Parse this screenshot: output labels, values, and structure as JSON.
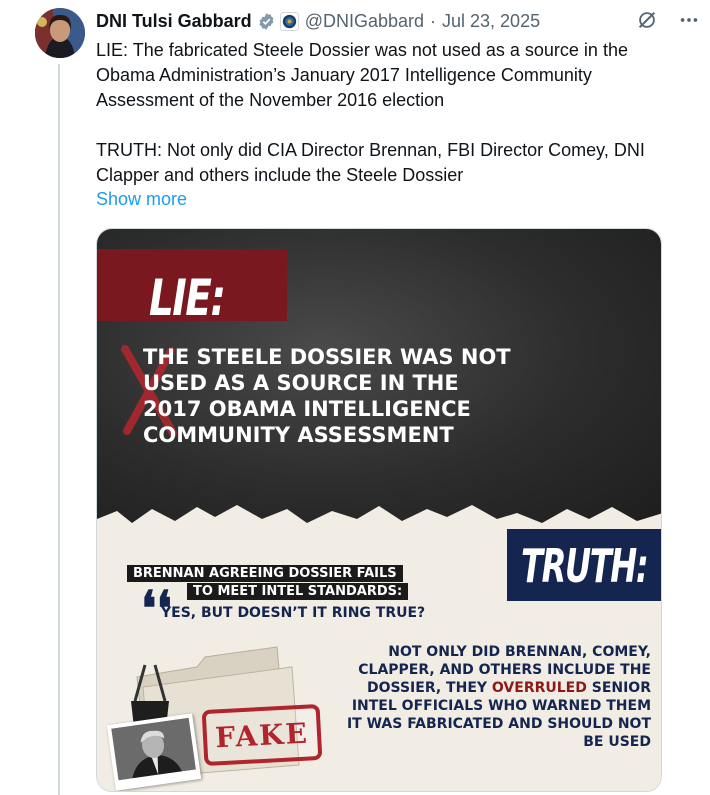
{
  "tweet": {
    "author_name": "DNI Tulsi Gabbard",
    "handle": "@DNIGabbard",
    "separator": "·",
    "date": "Jul 23, 2025",
    "paragraph_1": "LIE: The fabricated Steele Dossier was not used as a source in the Obama Administration’s January 2017 Intelligence Community Assessment of the November 2016 election",
    "paragraph_2": "TRUTH: Not only did CIA Director Brennan, FBI Director Comey, DNI Clapper and others include the Steele Dossier",
    "show_more": "Show more",
    "icons": [
      "verified-badge-icon",
      "government-affiliate-icon",
      "grok-icon",
      "more-icon"
    ]
  },
  "media": {
    "lie_label": "LIE:",
    "lie_body": "THE STEELE DOSSIER WAS NOT USED AS A SOURCE IN THE 2017 OBAMA INTELLIGENCE COMMUNITY ASSESSMENT",
    "truth_label": "TRUTH:",
    "quote_head_1": "BRENNAN AGREEING DOSSIER FAILS",
    "quote_head_2": "TO MEET INTEL STANDARDS:",
    "quote_marks": "❛❛",
    "quote_body": "YES, BUT DOESN’T IT RING TRUE?",
    "truth_body_1": "NOT ONLY DID BRENNAN, COMEY, CLAPPER, AND OTHERS INCLUDE THE DOSSIER, THEY ",
    "truth_body_red": "OVERRULED",
    "truth_body_2": " SENIOR INTEL OFFICIALS WHO WARNED THEM IT WAS FABRICATED AND SHOULD NOT BE USED",
    "stamp": "FAKE",
    "colors": {
      "lie_red": "#7a1820",
      "truth_navy": "#14264f",
      "stamp_red": "#b0252b",
      "link_blue": "#1d9bf0"
    }
  }
}
